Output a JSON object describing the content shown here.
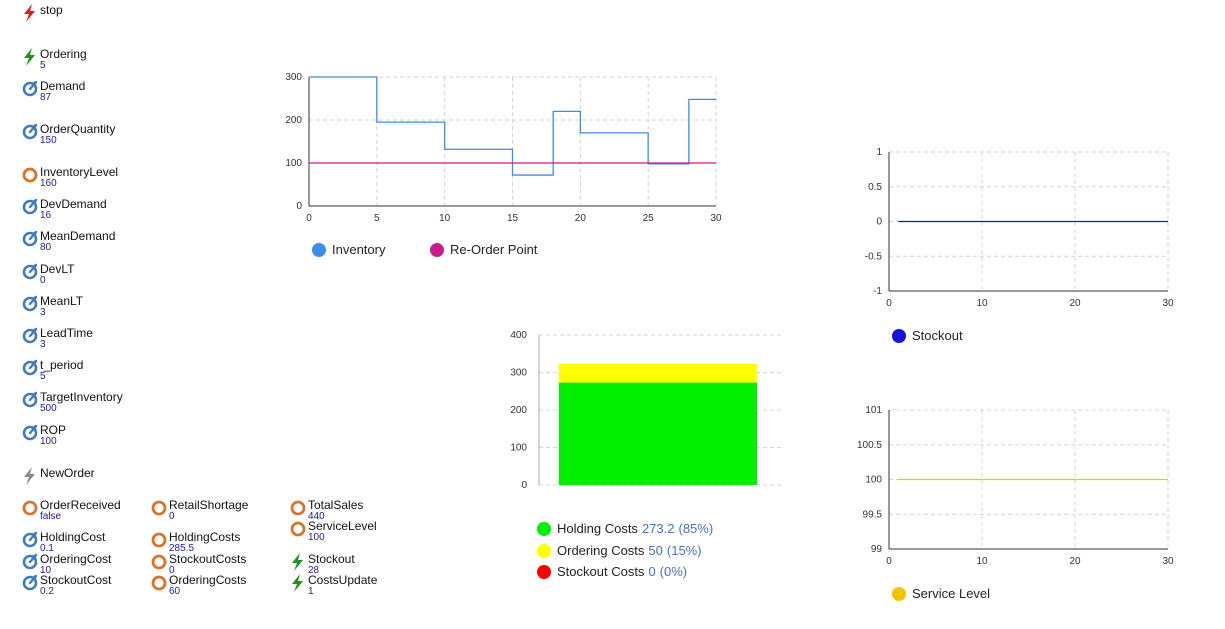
{
  "controls": [
    {
      "id": "stop",
      "icon": "bolt-red",
      "label": "stop",
      "value": ""
    },
    {
      "id": "ordering",
      "icon": "bolt-green",
      "label": "Ordering",
      "value": "5"
    },
    {
      "id": "demand",
      "icon": "gauge-blue",
      "label": "Demand",
      "value": "87"
    },
    {
      "id": "orderquantity",
      "icon": "gauge-blue",
      "label": "OrderQuantity",
      "value": "150"
    },
    {
      "id": "inventorylevel",
      "icon": "circle-orange",
      "label": "InventoryLevel",
      "value": "160"
    },
    {
      "id": "devdemand",
      "icon": "gauge-blue",
      "label": "DevDemand",
      "value": "16"
    },
    {
      "id": "meandemand",
      "icon": "gauge-blue",
      "label": "MeanDemand",
      "value": "80"
    },
    {
      "id": "devlt",
      "icon": "gauge-blue",
      "label": "DevLT",
      "value": "0"
    },
    {
      "id": "meanlt",
      "icon": "gauge-blue",
      "label": "MeanLT",
      "value": "3"
    },
    {
      "id": "leadtime",
      "icon": "gauge-blue",
      "label": "LeadTime",
      "value": "3"
    },
    {
      "id": "tperiod",
      "icon": "gauge-blue",
      "label": "t_period",
      "value": "5"
    },
    {
      "id": "targetinventory",
      "icon": "gauge-blue",
      "label": "TargetInventory",
      "value": "500"
    },
    {
      "id": "rop",
      "icon": "gauge-blue",
      "label": "ROP",
      "value": "100"
    },
    {
      "id": "neworder",
      "icon": "bolt-gray",
      "label": "NewOrder",
      "value": ""
    },
    {
      "id": "orderreceived",
      "icon": "circle-orange",
      "label": "OrderReceived",
      "value": "false"
    },
    {
      "id": "holdingcost",
      "icon": "gauge-blue",
      "label": "HoldingCost",
      "value": "0.1"
    },
    {
      "id": "orderingcost",
      "icon": "gauge-blue",
      "label": "OrderingCost",
      "value": "10"
    },
    {
      "id": "stockoutcost",
      "icon": "gauge-blue",
      "label": "StockoutCost",
      "value": "0.2"
    },
    {
      "id": "retailshortage",
      "icon": "circle-orange",
      "label": "RetailShortage",
      "value": "0"
    },
    {
      "id": "holdingcosts",
      "icon": "circle-orange",
      "label": "HoldingCosts",
      "value": "285.5"
    },
    {
      "id": "stockoutcosts",
      "icon": "circle-orange",
      "label": "StockoutCosts",
      "value": "0"
    },
    {
      "id": "orderingcosts",
      "icon": "circle-orange",
      "label": "OrderingCosts",
      "value": "60"
    },
    {
      "id": "totalsales",
      "icon": "circle-orange",
      "label": "TotalSales",
      "value": "440"
    },
    {
      "id": "servicelevel",
      "icon": "circle-orange",
      "label": "ServiceLevel",
      "value": "100"
    },
    {
      "id": "stockout",
      "icon": "bolt-green",
      "label": "Stockout",
      "value": "28"
    },
    {
      "id": "costsupdate",
      "icon": "bolt-green",
      "label": "CostsUpdate",
      "value": "1"
    }
  ],
  "chart_data": [
    {
      "id": "inventory-chart",
      "type": "line",
      "xlim": [
        0,
        30
      ],
      "ylim": [
        0,
        300
      ],
      "xticks": [
        0,
        5,
        10,
        15,
        20,
        25,
        30
      ],
      "yticks": [
        0,
        100,
        200,
        300
      ],
      "grid": true,
      "series": [
        {
          "name": "Inventory",
          "color": "#3d8ee8",
          "step": true,
          "x": [
            0,
            5,
            10,
            15,
            18,
            20,
            25,
            28,
            30
          ],
          "y": [
            300,
            195,
            132,
            72,
            220,
            170,
            98,
            248,
            248
          ]
        },
        {
          "name": "Re-Order Point",
          "color": "#c71f8a",
          "step": false,
          "x": [
            0,
            30
          ],
          "y": [
            100,
            100
          ]
        }
      ]
    },
    {
      "id": "stockout-chart",
      "type": "line",
      "xlim": [
        0,
        30
      ],
      "ylim": [
        -1,
        1
      ],
      "xticks": [
        0,
        10,
        20,
        30
      ],
      "yticks": [
        -1,
        -0.5,
        0,
        0.5,
        1
      ],
      "grid": true,
      "series": [
        {
          "name": "Stockout",
          "color": "#1414d6",
          "step": false,
          "x": [
            1,
            30
          ],
          "y": [
            0,
            0
          ]
        }
      ]
    },
    {
      "id": "servicelevel-chart",
      "type": "line",
      "xlim": [
        0,
        30
      ],
      "ylim": [
        99,
        101
      ],
      "xticks": [
        0,
        10,
        20,
        30
      ],
      "yticks": [
        99,
        99.5,
        100,
        100.5,
        101
      ],
      "grid": true,
      "series": [
        {
          "name": "Service Level",
          "color": "#f5c400",
          "step": false,
          "x": [
            1,
            30
          ],
          "y": [
            100,
            100
          ]
        }
      ]
    },
    {
      "id": "costs-chart",
      "type": "bar",
      "stacked": true,
      "ylim": [
        0,
        400
      ],
      "yticks": [
        0,
        100,
        200,
        300,
        400
      ],
      "grid": true,
      "series": [
        {
          "name": "Holding Costs",
          "color": "#00f000",
          "value": 273.2,
          "value_label": "273.2",
          "pct_label": "(85%)"
        },
        {
          "name": "Ordering Costs",
          "color": "#ffff00",
          "value": 50,
          "value_label": "50",
          "pct_label": "(15%)"
        },
        {
          "name": "Stockout Costs",
          "color": "#ff0000",
          "value": 0,
          "value_label": "0",
          "pct_label": "(0%)"
        }
      ]
    }
  ]
}
